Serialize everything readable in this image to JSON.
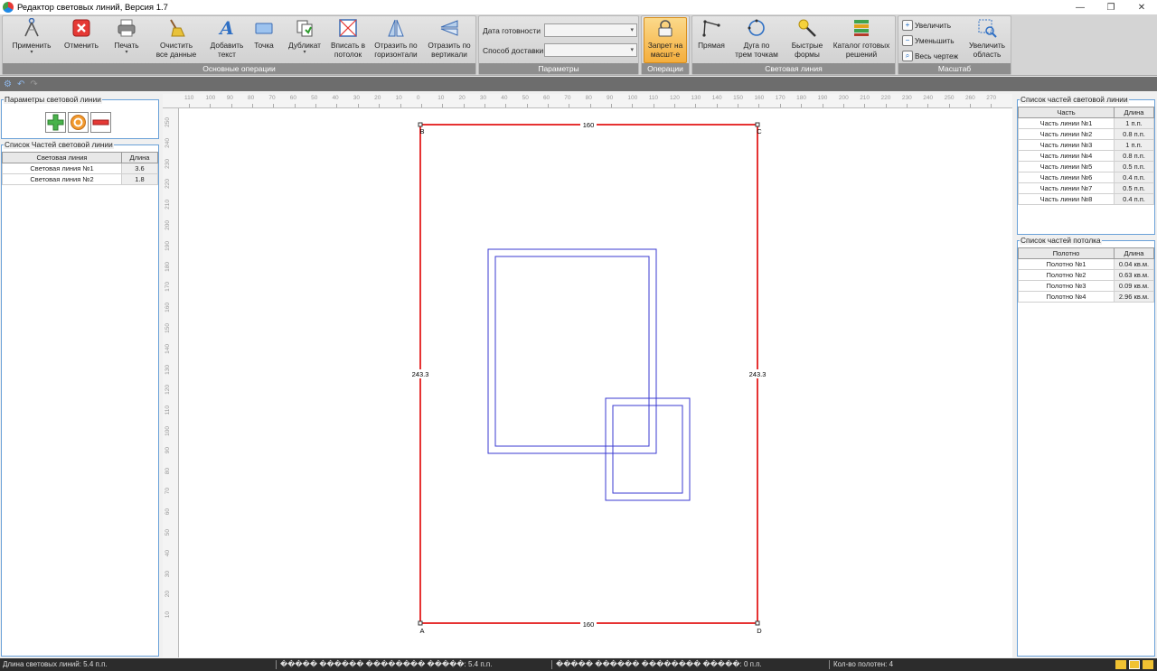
{
  "window": {
    "title": "Редактор световых линий, Версия 1.7",
    "controls": [
      "—",
      "❐",
      "✕"
    ]
  },
  "ribbon": {
    "groups": {
      "main": "Основные операции",
      "params": "Параметры",
      "ops": "Операции",
      "lightline": "Световая линия",
      "scale": "Масштаб"
    },
    "buttons": {
      "apply": "Применить",
      "cancel": "Отменить",
      "print": "Печать",
      "clear": "Очистить\nвсе данные",
      "add_text": "Добавить\nтекст",
      "point": "Точка",
      "duplicate": "Дубликат",
      "fit": "Вписать в\nпотолок",
      "flip_h": "Отразить по\nгоризонтали",
      "flip_v": "Отразить по\nвертикали",
      "no_scale": "Запрет на\nмасшт-е",
      "line": "Прямая",
      "arc": "Дуга по\nтрем точкам",
      "quick_shapes": "Быстрые\nформы",
      "catalog": "Каталог готовых\nрешений",
      "zoom_area": "Увеличить\nобласть"
    },
    "params": {
      "ready_date_label": "Дата готовности",
      "delivery_label": "Способ доставки",
      "ready_date_value": "",
      "delivery_value": ""
    },
    "zoom": {
      "in": "Увеличить",
      "out": "Уменьшить",
      "all": "Весь чертеж"
    }
  },
  "left": {
    "params_title": "Параметры световой линии",
    "parts_title": "Список Частей световой линии",
    "columns": [
      "Световая линия",
      "Длина"
    ],
    "rows": [
      [
        "Световая линия №1",
        "3.6"
      ],
      [
        "Световая линия №2",
        "1.8"
      ]
    ]
  },
  "right": {
    "parts_title": "Список частей световой линии",
    "parts_columns": [
      "Часть",
      "Длина"
    ],
    "parts_rows": [
      [
        "Часть линии №1",
        "1 п.п."
      ],
      [
        "Часть линии №2",
        "0.8 п.п."
      ],
      [
        "Часть линии №3",
        "1 п.п."
      ],
      [
        "Часть линии №4",
        "0.8 п.п."
      ],
      [
        "Часть линии №5",
        "0.5 п.п."
      ],
      [
        "Часть линии №6",
        "0.4 п.п."
      ],
      [
        "Часть линии №7",
        "0.5 п.п."
      ],
      [
        "Часть линии №8",
        "0.4 п.п."
      ]
    ],
    "ceiling_title": "Список частей потолка",
    "ceiling_columns": [
      "Полотно",
      "Длина"
    ],
    "ceiling_rows": [
      [
        "Полотно №1",
        "0.04 кв.м."
      ],
      [
        "Полотно №2",
        "0.63 кв.м."
      ],
      [
        "Полотно №3",
        "0.09 кв.м."
      ],
      [
        "Полотно №4",
        "2.96 кв.м."
      ]
    ]
  },
  "drawing": {
    "top_label": "160",
    "bottom_label": "160",
    "left_label": "243.3",
    "right_label": "243.3",
    "corners": {
      "a": "A",
      "b": "B",
      "c": "C",
      "d": "D"
    },
    "ruler_top": [
      "110",
      "100",
      "90",
      "80",
      "70",
      "60",
      "50",
      "40",
      "30",
      "20",
      "10",
      "0",
      "10",
      "20",
      "30",
      "40",
      "50",
      "60",
      "70",
      "80",
      "90",
      "100",
      "110",
      "120",
      "130",
      "140",
      "150",
      "160",
      "170",
      "180",
      "190",
      "200",
      "210",
      "220",
      "230",
      "240",
      "250",
      "260",
      "270"
    ],
    "ruler_left": [
      "250",
      "240",
      "230",
      "220",
      "210",
      "200",
      "190",
      "180",
      "170",
      "160",
      "150",
      "140",
      "130",
      "120",
      "110",
      "100",
      "90",
      "80",
      "70",
      "60",
      "50",
      "40",
      "30",
      "20",
      "10"
    ],
    "colors": {
      "border": "#e00000",
      "inner": "#3a3ad0"
    }
  },
  "status": {
    "total_length": "Длина световых линий: 5.4 п.п.",
    "field2": "����� ������ �������� �����: 5.4 п.п.",
    "field3": "����� ������ �������� �����: 0 п.п.",
    "panels_count": "Кол-во полотен: 4"
  }
}
